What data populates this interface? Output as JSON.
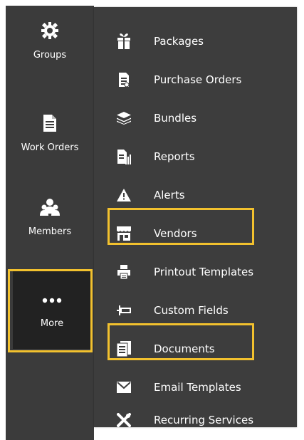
{
  "sidebar": {
    "items": [
      {
        "label": "Groups",
        "icon": "gear-icon"
      },
      {
        "label": "Work Orders",
        "icon": "document-icon"
      },
      {
        "label": "Members",
        "icon": "members-icon"
      },
      {
        "label": "More",
        "icon": "more-dots-icon"
      }
    ]
  },
  "menu": {
    "items": [
      {
        "label": "Packages",
        "icon": "gift-icon"
      },
      {
        "label": "Purchase Orders",
        "icon": "purchase-order-icon"
      },
      {
        "label": "Bundles",
        "icon": "layers-icon"
      },
      {
        "label": "Reports",
        "icon": "report-chart-icon"
      },
      {
        "label": "Alerts",
        "icon": "alert-triangle-icon"
      },
      {
        "label": "Vendors",
        "icon": "storefront-icon"
      },
      {
        "label": "Printout Templates",
        "icon": "printer-icon"
      },
      {
        "label": "Custom Fields",
        "icon": "custom-field-icon"
      },
      {
        "label": "Documents",
        "icon": "documents-icon"
      },
      {
        "label": "Email Templates",
        "icon": "envelope-icon"
      },
      {
        "label": "Recurring Services",
        "icon": "tools-icon"
      }
    ]
  },
  "colors": {
    "sidebar_bg": "#3b3b3b",
    "menu_bg": "#3d3d3d",
    "active_bg": "#222222",
    "highlight": "#f2c12e",
    "text": "#ffffff"
  }
}
